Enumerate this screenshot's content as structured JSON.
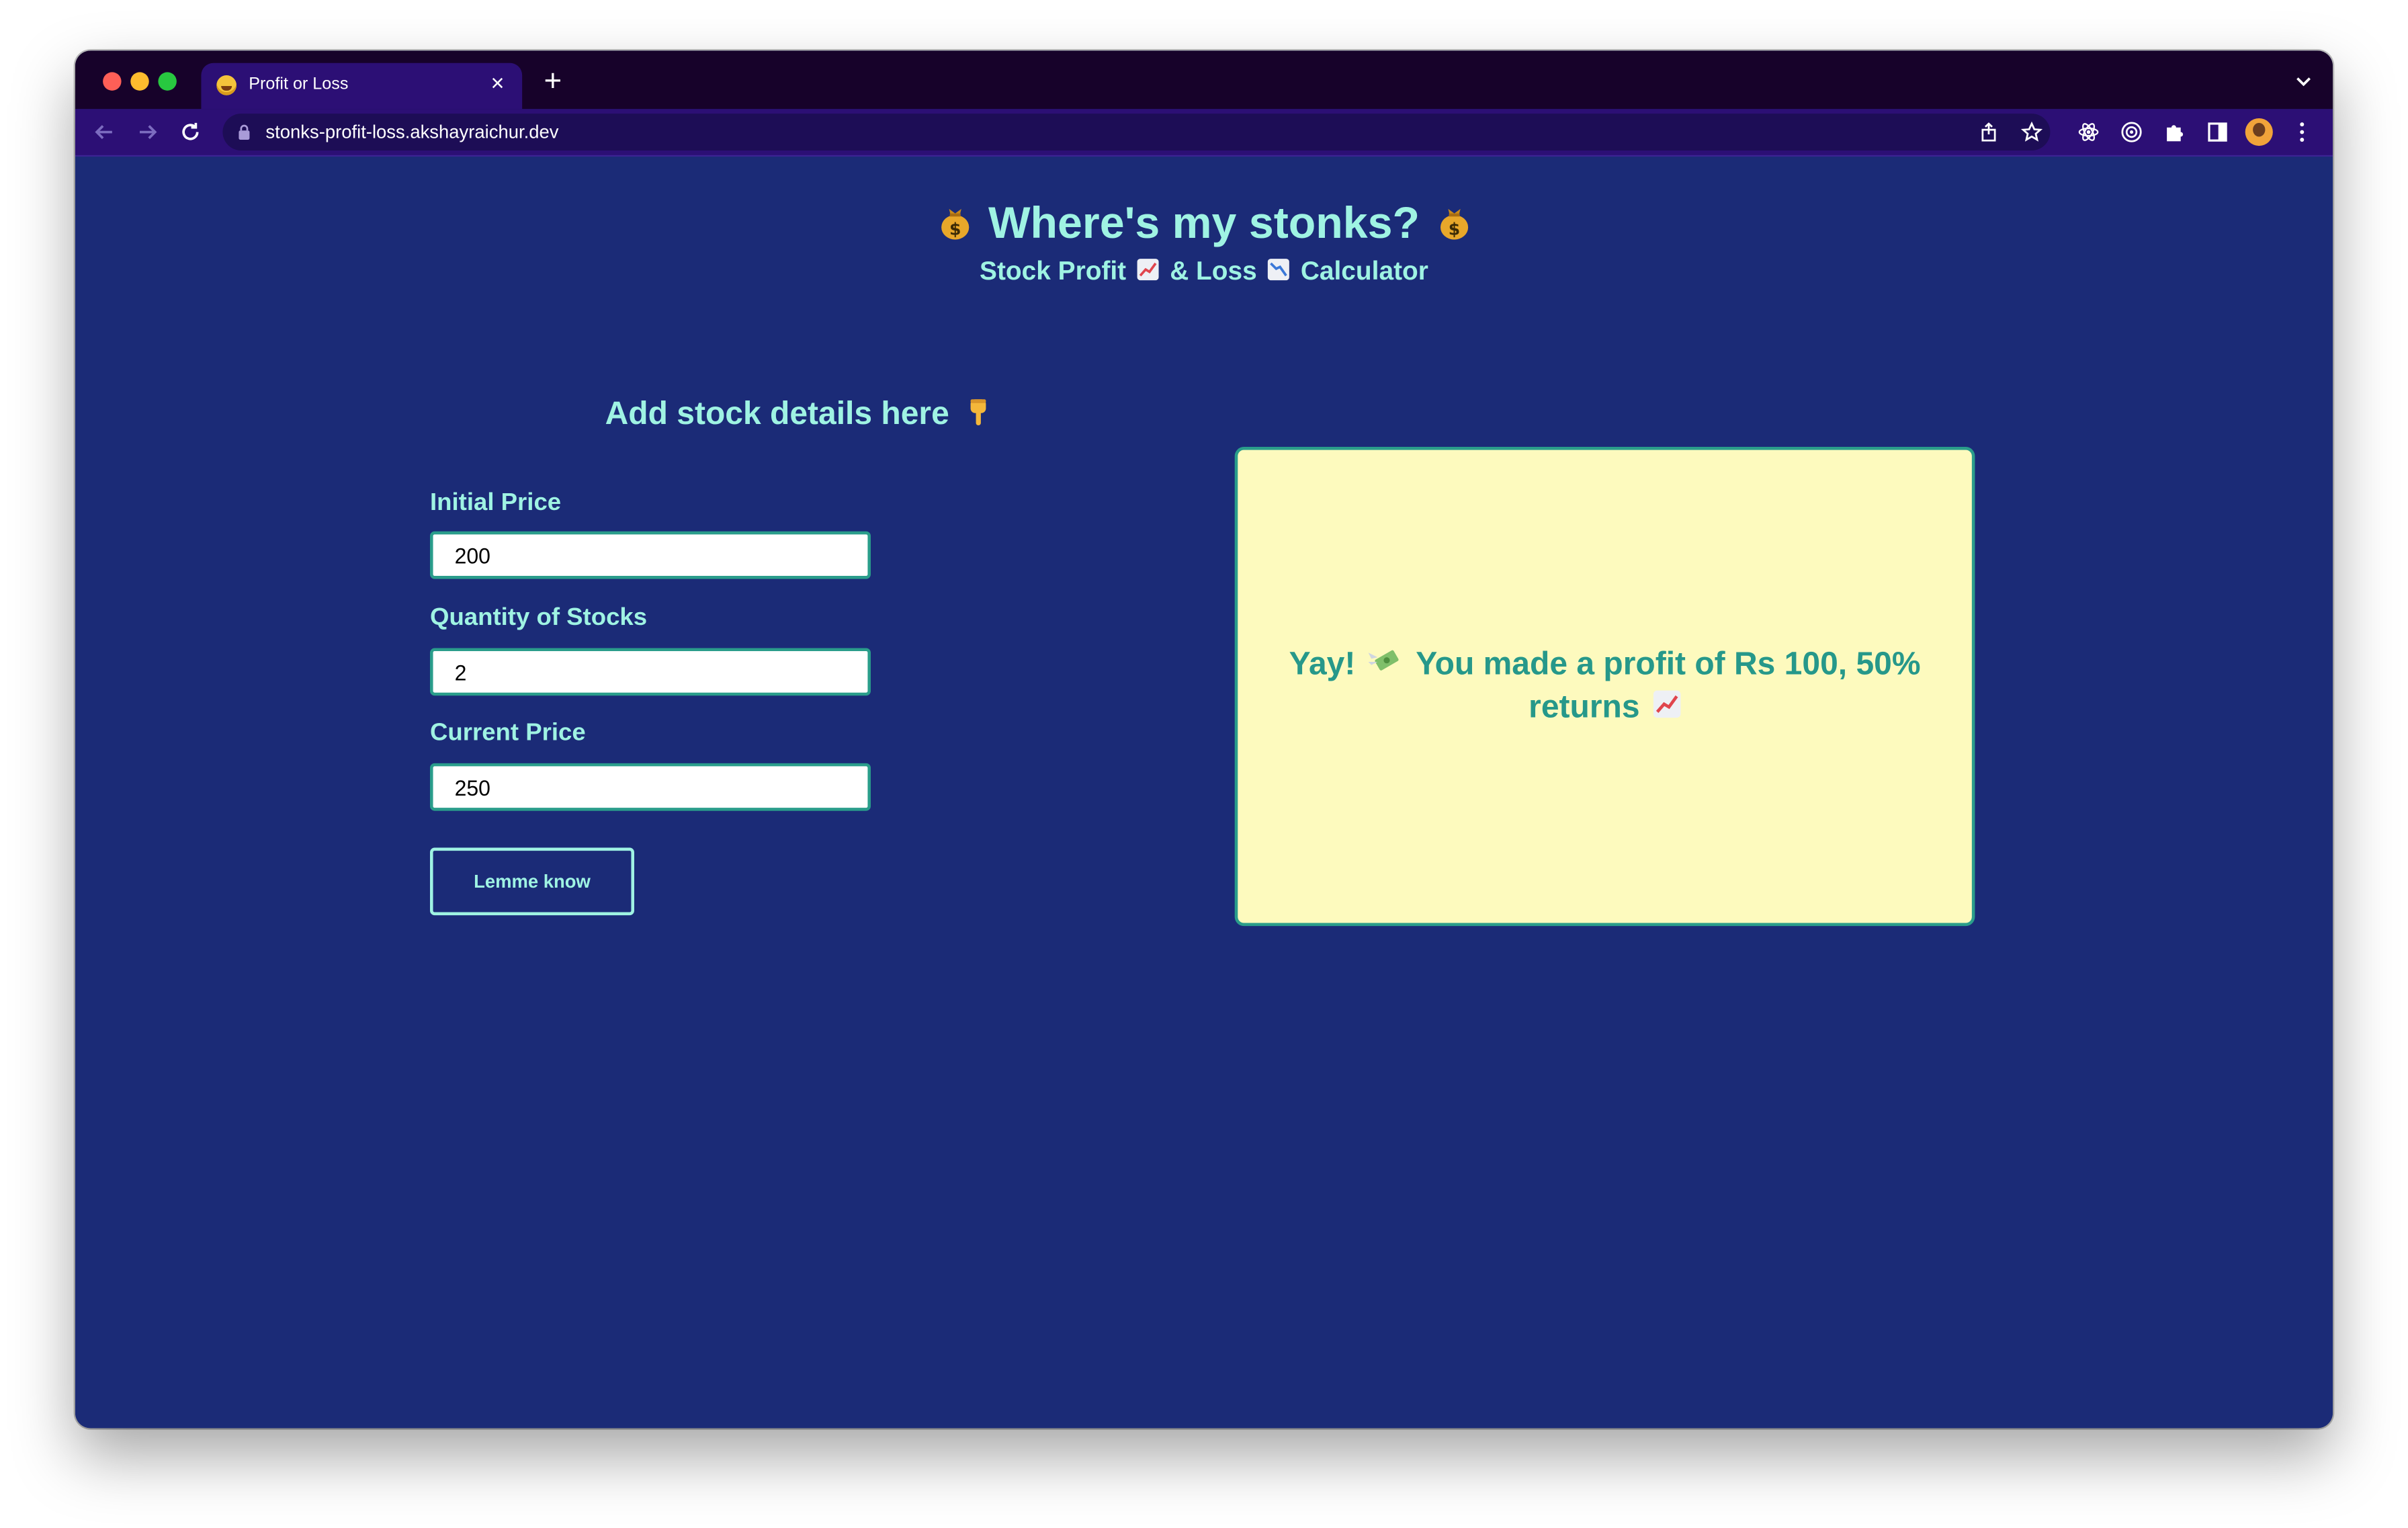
{
  "browser": {
    "tab_title": "Profit or Loss",
    "tab_close": "×",
    "new_tab": "+",
    "url": "stonks-profit-loss.akshayraichur.dev"
  },
  "page": {
    "heading": "Where's my stonks?",
    "subheading_part1": "Stock Profit",
    "subheading_part2": "& Loss",
    "subheading_part3": "Calculator",
    "form_title": "Add stock details here",
    "initial_price_label": "Initial Price",
    "initial_price_value": "200",
    "quantity_label": "Quantity of Stocks",
    "quantity_value": "2",
    "current_price_label": "Current Price",
    "current_price_value": "250",
    "submit_label": "Lemme know",
    "result_part1": "Yay!",
    "result_part2": "You made a profit of Rs 100, 50% returns"
  },
  "colors": {
    "page_bg": "#1b2b77",
    "accent_text": "#9ff3e3",
    "result_bg": "#fdfabe",
    "result_text": "#26988a",
    "input_border": "#2a9d8b",
    "tab_active": "#2c0f75",
    "titlebar": "#17022a"
  },
  "icons": [
    "money-bag-icon",
    "chart-increasing-icon",
    "chart-decreasing-icon",
    "pointing-down-icon",
    "money-with-wings-icon"
  ]
}
